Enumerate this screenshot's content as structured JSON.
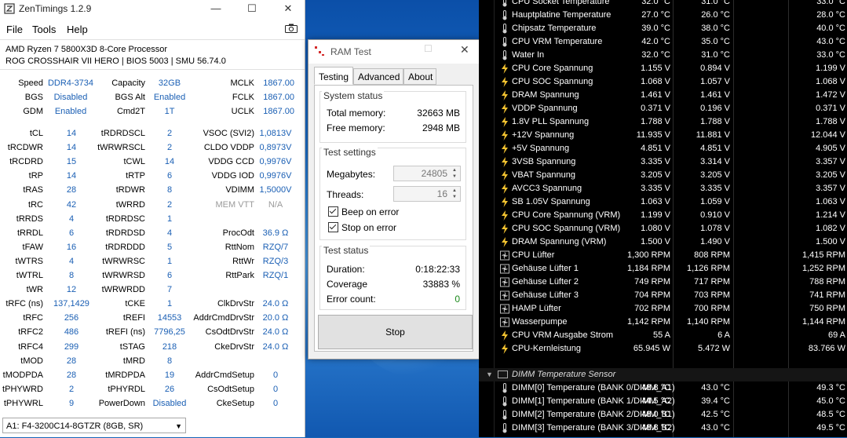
{
  "zentimings": {
    "title": "ZenTimings 1.2.9",
    "menu": [
      "File",
      "Tools",
      "Help"
    ],
    "cpu": "AMD Ryzen 7 5800X3D 8-Core Processor",
    "board": "ROG CROSSHAIR VII HERO | BIOS 5003 | SMU 56.74.0",
    "top_rows": [
      [
        "Speed",
        "DDR4-3734",
        "Capacity",
        "32GB",
        "MCLK",
        "1867.00"
      ],
      [
        "BGS",
        "Disabled",
        "BGS Alt",
        "Enabled",
        "FCLK",
        "1867.00"
      ],
      [
        "GDM",
        "Enabled",
        "Cmd2T",
        "1T",
        "UCLK",
        "1867.00"
      ]
    ],
    "timing_rows": [
      [
        "tCL",
        "14",
        "tRDRDSCL",
        "2",
        "VSOC (SVI2)",
        "1,0813V"
      ],
      [
        "tRCDWR",
        "14",
        "tWRWRSCL",
        "2",
        "CLDO VDDP",
        "0,8973V"
      ],
      [
        "tRCDRD",
        "15",
        "tCWL",
        "14",
        "VDDG CCD",
        "0,9976V"
      ],
      [
        "tRP",
        "14",
        "tRTP",
        "6",
        "VDDG IOD",
        "0,9976V"
      ],
      [
        "tRAS",
        "28",
        "tRDWR",
        "8",
        "VDIMM",
        "1,5000V"
      ],
      [
        "tRC",
        "42",
        "tWRRD",
        "2",
        "MEM VTT",
        "N/A"
      ],
      [
        "tRRDS",
        "4",
        "tRDRDSC",
        "1",
        "",
        ""
      ],
      [
        "tRRDL",
        "6",
        "tRDRDSD",
        "4",
        "ProcOdt",
        "36.9 Ω"
      ],
      [
        "tFAW",
        "16",
        "tRDRDDD",
        "5",
        "RttNom",
        "RZQ/7"
      ],
      [
        "tWTRS",
        "4",
        "tWRWRSC",
        "1",
        "RttWr",
        "RZQ/3"
      ],
      [
        "tWTRL",
        "8",
        "tWRWRSD",
        "6",
        "RttPark",
        "RZQ/1"
      ],
      [
        "tWR",
        "12",
        "tWRWRDD",
        "7",
        "",
        ""
      ],
      [
        "tRFC (ns)",
        "137,1429",
        "tCKE",
        "1",
        "ClkDrvStr",
        "24.0 Ω"
      ],
      [
        "tRFC",
        "256",
        "tREFI",
        "14553",
        "AddrCmdDrvStr",
        "20.0 Ω"
      ],
      [
        "tRFC2",
        "486",
        "tREFI (ns)",
        "7796,25",
        "CsOdtDrvStr",
        "24.0 Ω"
      ],
      [
        "tRFC4",
        "299",
        "tSTAG",
        "218",
        "CkeDrvStr",
        "24.0 Ω"
      ],
      [
        "tMOD",
        "28",
        "tMRD",
        "8",
        "",
        ""
      ],
      [
        "tMODPDA",
        "28",
        "tMRDPDA",
        "19",
        "AddrCmdSetup",
        "0"
      ],
      [
        "tPHYWRD",
        "2",
        "tPHYRDL",
        "26",
        "CsOdtSetup",
        "0"
      ],
      [
        "tPHYWRL",
        "9",
        "PowerDown",
        "Disabled",
        "CkeSetup",
        "0"
      ]
    ],
    "dimm_select": "A1: F4-3200C14-8GTZR (8GB, SR)"
  },
  "ramtest": {
    "title": "RAM Test",
    "tabs": [
      "Testing",
      "Advanced",
      "About"
    ],
    "system_status_title": "System status",
    "total_memory_label": "Total memory:",
    "total_memory": "32663 MB",
    "free_memory_label": "Free memory:",
    "free_memory": "2948 MB",
    "test_settings_title": "Test settings",
    "megabytes_label": "Megabytes:",
    "megabytes": "24805",
    "threads_label": "Threads:",
    "threads": "16",
    "beep_label": "Beep on error",
    "stop_label": "Stop on error",
    "test_status_title": "Test status",
    "duration_label": "Duration:",
    "duration": "0:18:22:33",
    "coverage_label": "Coverage",
    "coverage": "33883 %",
    "errors_label": "Error count:",
    "errors": "0",
    "stop_button": "Stop"
  },
  "hwinfo": {
    "rows": [
      {
        "icon": "thermometer",
        "name": "CPU Socket Temperature",
        "a": "32.0 °C",
        "b": "31.0 °C",
        "c": "33.0 °C"
      },
      {
        "icon": "thermometer",
        "name": "Hauptplatine Temperature",
        "a": "27.0 °C",
        "b": "26.0 °C",
        "c": "28.0 °C"
      },
      {
        "icon": "thermometer",
        "name": "Chipsatz Temperature",
        "a": "39.0 °C",
        "b": "38.0 °C",
        "c": "40.0 °C"
      },
      {
        "icon": "thermometer",
        "name": "CPU VRM Temperature",
        "a": "42.0 °C",
        "b": "35.0 °C",
        "c": "43.0 °C"
      },
      {
        "icon": "thermometer",
        "name": "Water In",
        "a": "32.0 °C",
        "b": "31.0 °C",
        "c": "33.0 °C"
      },
      {
        "icon": "bolt",
        "name": "CPU Core Spannung",
        "a": "1.155 V",
        "b": "0.894 V",
        "c": "1.199 V"
      },
      {
        "icon": "bolt",
        "name": "CPU SOC Spannung",
        "a": "1.068 V",
        "b": "1.057 V",
        "c": "1.068 V"
      },
      {
        "icon": "bolt",
        "name": "DRAM Spannung",
        "a": "1.461 V",
        "b": "1.461 V",
        "c": "1.472 V"
      },
      {
        "icon": "bolt",
        "name": "VDDP Spannung",
        "a": "0.371 V",
        "b": "0.196 V",
        "c": "0.371 V"
      },
      {
        "icon": "bolt",
        "name": "1.8V PLL Spannung",
        "a": "1.788 V",
        "b": "1.788 V",
        "c": "1.788 V"
      },
      {
        "icon": "bolt",
        "name": "+12V Spannung",
        "a": "11.935 V",
        "b": "11.881 V",
        "c": "12.044 V"
      },
      {
        "icon": "bolt",
        "name": "+5V Spannung",
        "a": "4.851 V",
        "b": "4.851 V",
        "c": "4.905 V"
      },
      {
        "icon": "bolt",
        "name": "3VSB Spannung",
        "a": "3.335 V",
        "b": "3.314 V",
        "c": "3.357 V"
      },
      {
        "icon": "bolt",
        "name": "VBAT Spannung",
        "a": "3.205 V",
        "b": "3.205 V",
        "c": "3.205 V"
      },
      {
        "icon": "bolt",
        "name": "AVCC3 Spannung",
        "a": "3.335 V",
        "b": "3.335 V",
        "c": "3.357 V"
      },
      {
        "icon": "bolt",
        "name": "SB 1.05V Spannung",
        "a": "1.063 V",
        "b": "1.059 V",
        "c": "1.063 V"
      },
      {
        "icon": "bolt",
        "name": "CPU Core Spannung (VRM)",
        "a": "1.199 V",
        "b": "0.910 V",
        "c": "1.214 V"
      },
      {
        "icon": "bolt",
        "name": "CPU SOC Spannung (VRM)",
        "a": "1.080 V",
        "b": "1.078 V",
        "c": "1.082 V"
      },
      {
        "icon": "bolt",
        "name": "DRAM Spannung (VRM)",
        "a": "1.500 V",
        "b": "1.490 V",
        "c": "1.500 V"
      },
      {
        "icon": "fan",
        "name": "CPU Lüfter",
        "a": "1,300 RPM",
        "b": "808 RPM",
        "c": "1,415 RPM"
      },
      {
        "icon": "fan",
        "name": "Gehäuse Lüfter 1",
        "a": "1,184 RPM",
        "b": "1,126 RPM",
        "c": "1,252 RPM"
      },
      {
        "icon": "fan",
        "name": "Gehäuse Lüfter 2",
        "a": "749 RPM",
        "b": "717 RPM",
        "c": "788 RPM"
      },
      {
        "icon": "fan",
        "name": "Gehäuse Lüfter 3",
        "a": "704 RPM",
        "b": "703 RPM",
        "c": "741 RPM"
      },
      {
        "icon": "fan",
        "name": "HAMP Lüfter",
        "a": "702 RPM",
        "b": "700 RPM",
        "c": "750 RPM"
      },
      {
        "icon": "fan",
        "name": "Wasserpumpe",
        "a": "1,142 RPM",
        "b": "1,140 RPM",
        "c": "1,144 RPM"
      },
      {
        "icon": "bolt",
        "name": "CPU VRM Ausgabe Strom",
        "a": "55 A",
        "b": "6 A",
        "c": "69 A"
      },
      {
        "icon": "bolt",
        "name": "CPU-Kernleistung",
        "a": "65.945 W",
        "b": "5.472 W",
        "c": "83.766 W"
      }
    ],
    "group_title": "DIMM Temperature Sensor",
    "group_rows": [
      {
        "icon": "thermometer",
        "name": "DIMM[0] Temperature (BANK 0/DIMM_A1)",
        "a": "48.8 °C",
        "b": "43.0 °C",
        "c": "49.3 °C"
      },
      {
        "icon": "thermometer",
        "name": "DIMM[1] Temperature (BANK 1/DIMM_A2)",
        "a": "44.5 °C",
        "b": "39.4 °C",
        "c": "45.0 °C"
      },
      {
        "icon": "thermometer",
        "name": "DIMM[2] Temperature (BANK 2/DIMM_B1)",
        "a": "48.0 °C",
        "b": "42.5 °C",
        "c": "48.5 °C"
      },
      {
        "icon": "thermometer",
        "name": "DIMM[3] Temperature (BANK 3/DIMM_B2)",
        "a": "48.8 °C",
        "b": "43.0 °C",
        "c": "49.5 °C"
      }
    ]
  }
}
